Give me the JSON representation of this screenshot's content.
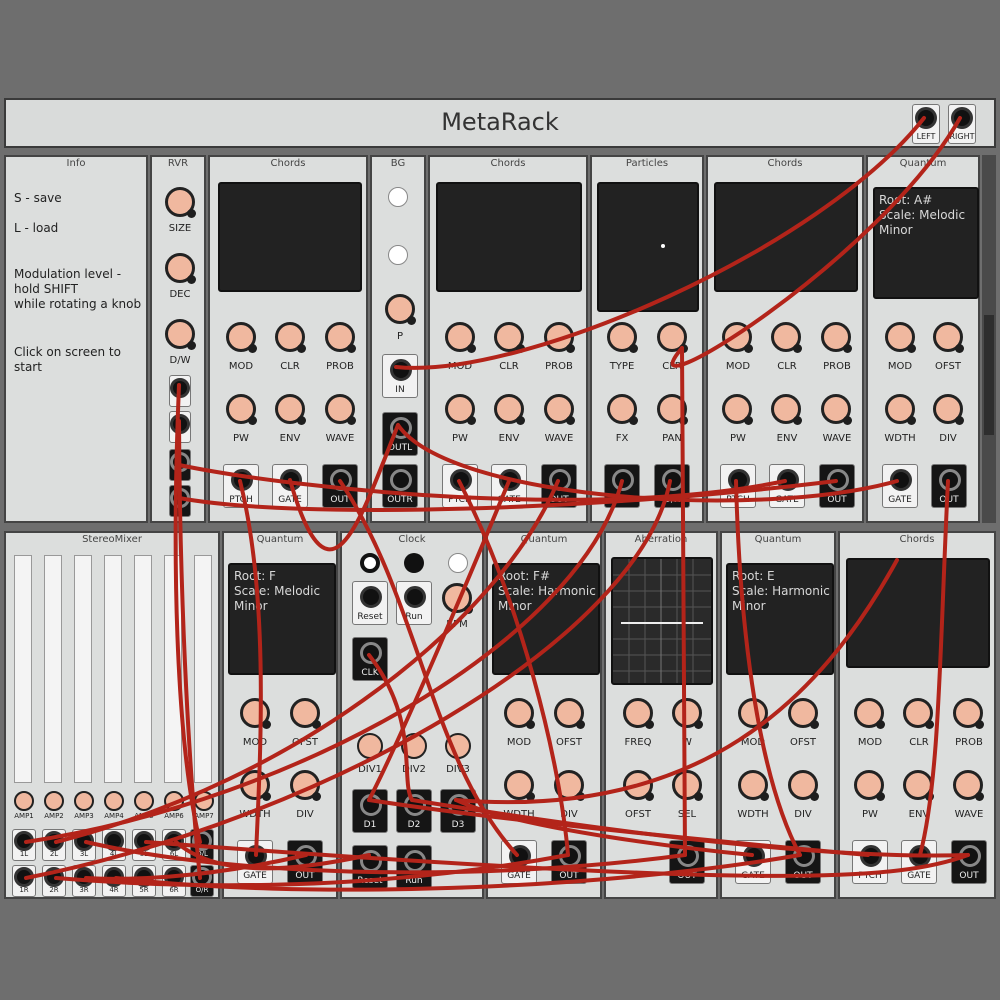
{
  "rack_title": "MetaRack",
  "out_jacks": {
    "left": "LEFT",
    "right": "RIGHT"
  },
  "info": {
    "title": "Info",
    "lines": [
      "S - save",
      "L - load",
      "Modulation level -\nhold SHIFT\nwhile rotating a knob",
      "Click on screen to start"
    ]
  },
  "rvr": {
    "title": "RVR",
    "knobs": [
      "SIZE",
      "DEC",
      "D/W"
    ]
  },
  "bg": {
    "title": "BG",
    "knob": "P",
    "jacks": [
      "IN",
      "OUTL",
      "OUTR"
    ]
  },
  "chords_labels": {
    "title": "Chords",
    "row1": [
      "MOD",
      "CLR",
      "PROB"
    ],
    "row2": [
      "PW",
      "ENV",
      "WAVE"
    ],
    "jacks": [
      "PTCH",
      "GATE",
      "OUT"
    ]
  },
  "particles": {
    "title": "Particles",
    "row1": [
      "TYPE",
      "CLR"
    ],
    "row2": [
      "FX",
      "PAN"
    ],
    "jacks": [
      "O/L",
      "O/R"
    ]
  },
  "quantum_labels": {
    "title": "Quantum",
    "row1": [
      "MOD",
      "OFST"
    ],
    "row2": [
      "WDTH",
      "DIV"
    ],
    "jacks": [
      "GATE",
      "OUT"
    ]
  },
  "quantum_screens": [
    "Root: A#\nScale: Melodic\nMinor",
    "Root: F\nScale: Melodic\nMinor",
    "Root: F#\nScale: Harmonic\nMinor",
    "Root: E\nScale: Harmonic\nMinor"
  ],
  "stereomixer": {
    "title": "StereoMixer",
    "amps": [
      "AMP1",
      "AMP2",
      "AMP3",
      "AMP4",
      "AMP5",
      "AMP6",
      "AMP7"
    ],
    "row1": [
      "1L",
      "2L",
      "3L",
      "4L",
      "5L",
      "6L",
      "O/L"
    ],
    "row2": [
      "1R",
      "2R",
      "3R",
      "4R",
      "5R",
      "6R",
      "O/R"
    ]
  },
  "clock": {
    "title": "Clock",
    "buttons": [
      "Reset",
      "Run"
    ],
    "knob": "BPM",
    "clk": "CLK",
    "divs": [
      "DIV1",
      "DIV2",
      "DIV3"
    ],
    "outs": [
      "D1",
      "D2",
      "D3",
      "Reset",
      "Run"
    ]
  },
  "aberration": {
    "title": "Aberration",
    "row1": [
      "FREQ",
      "W"
    ],
    "row2": [
      "OFST",
      "SEL"
    ],
    "jack": "OUT"
  },
  "colors": {
    "cable": "#b3241a",
    "knob": "#f0b89f",
    "panel": "#dcdedd",
    "background": "#6e6e6e"
  }
}
